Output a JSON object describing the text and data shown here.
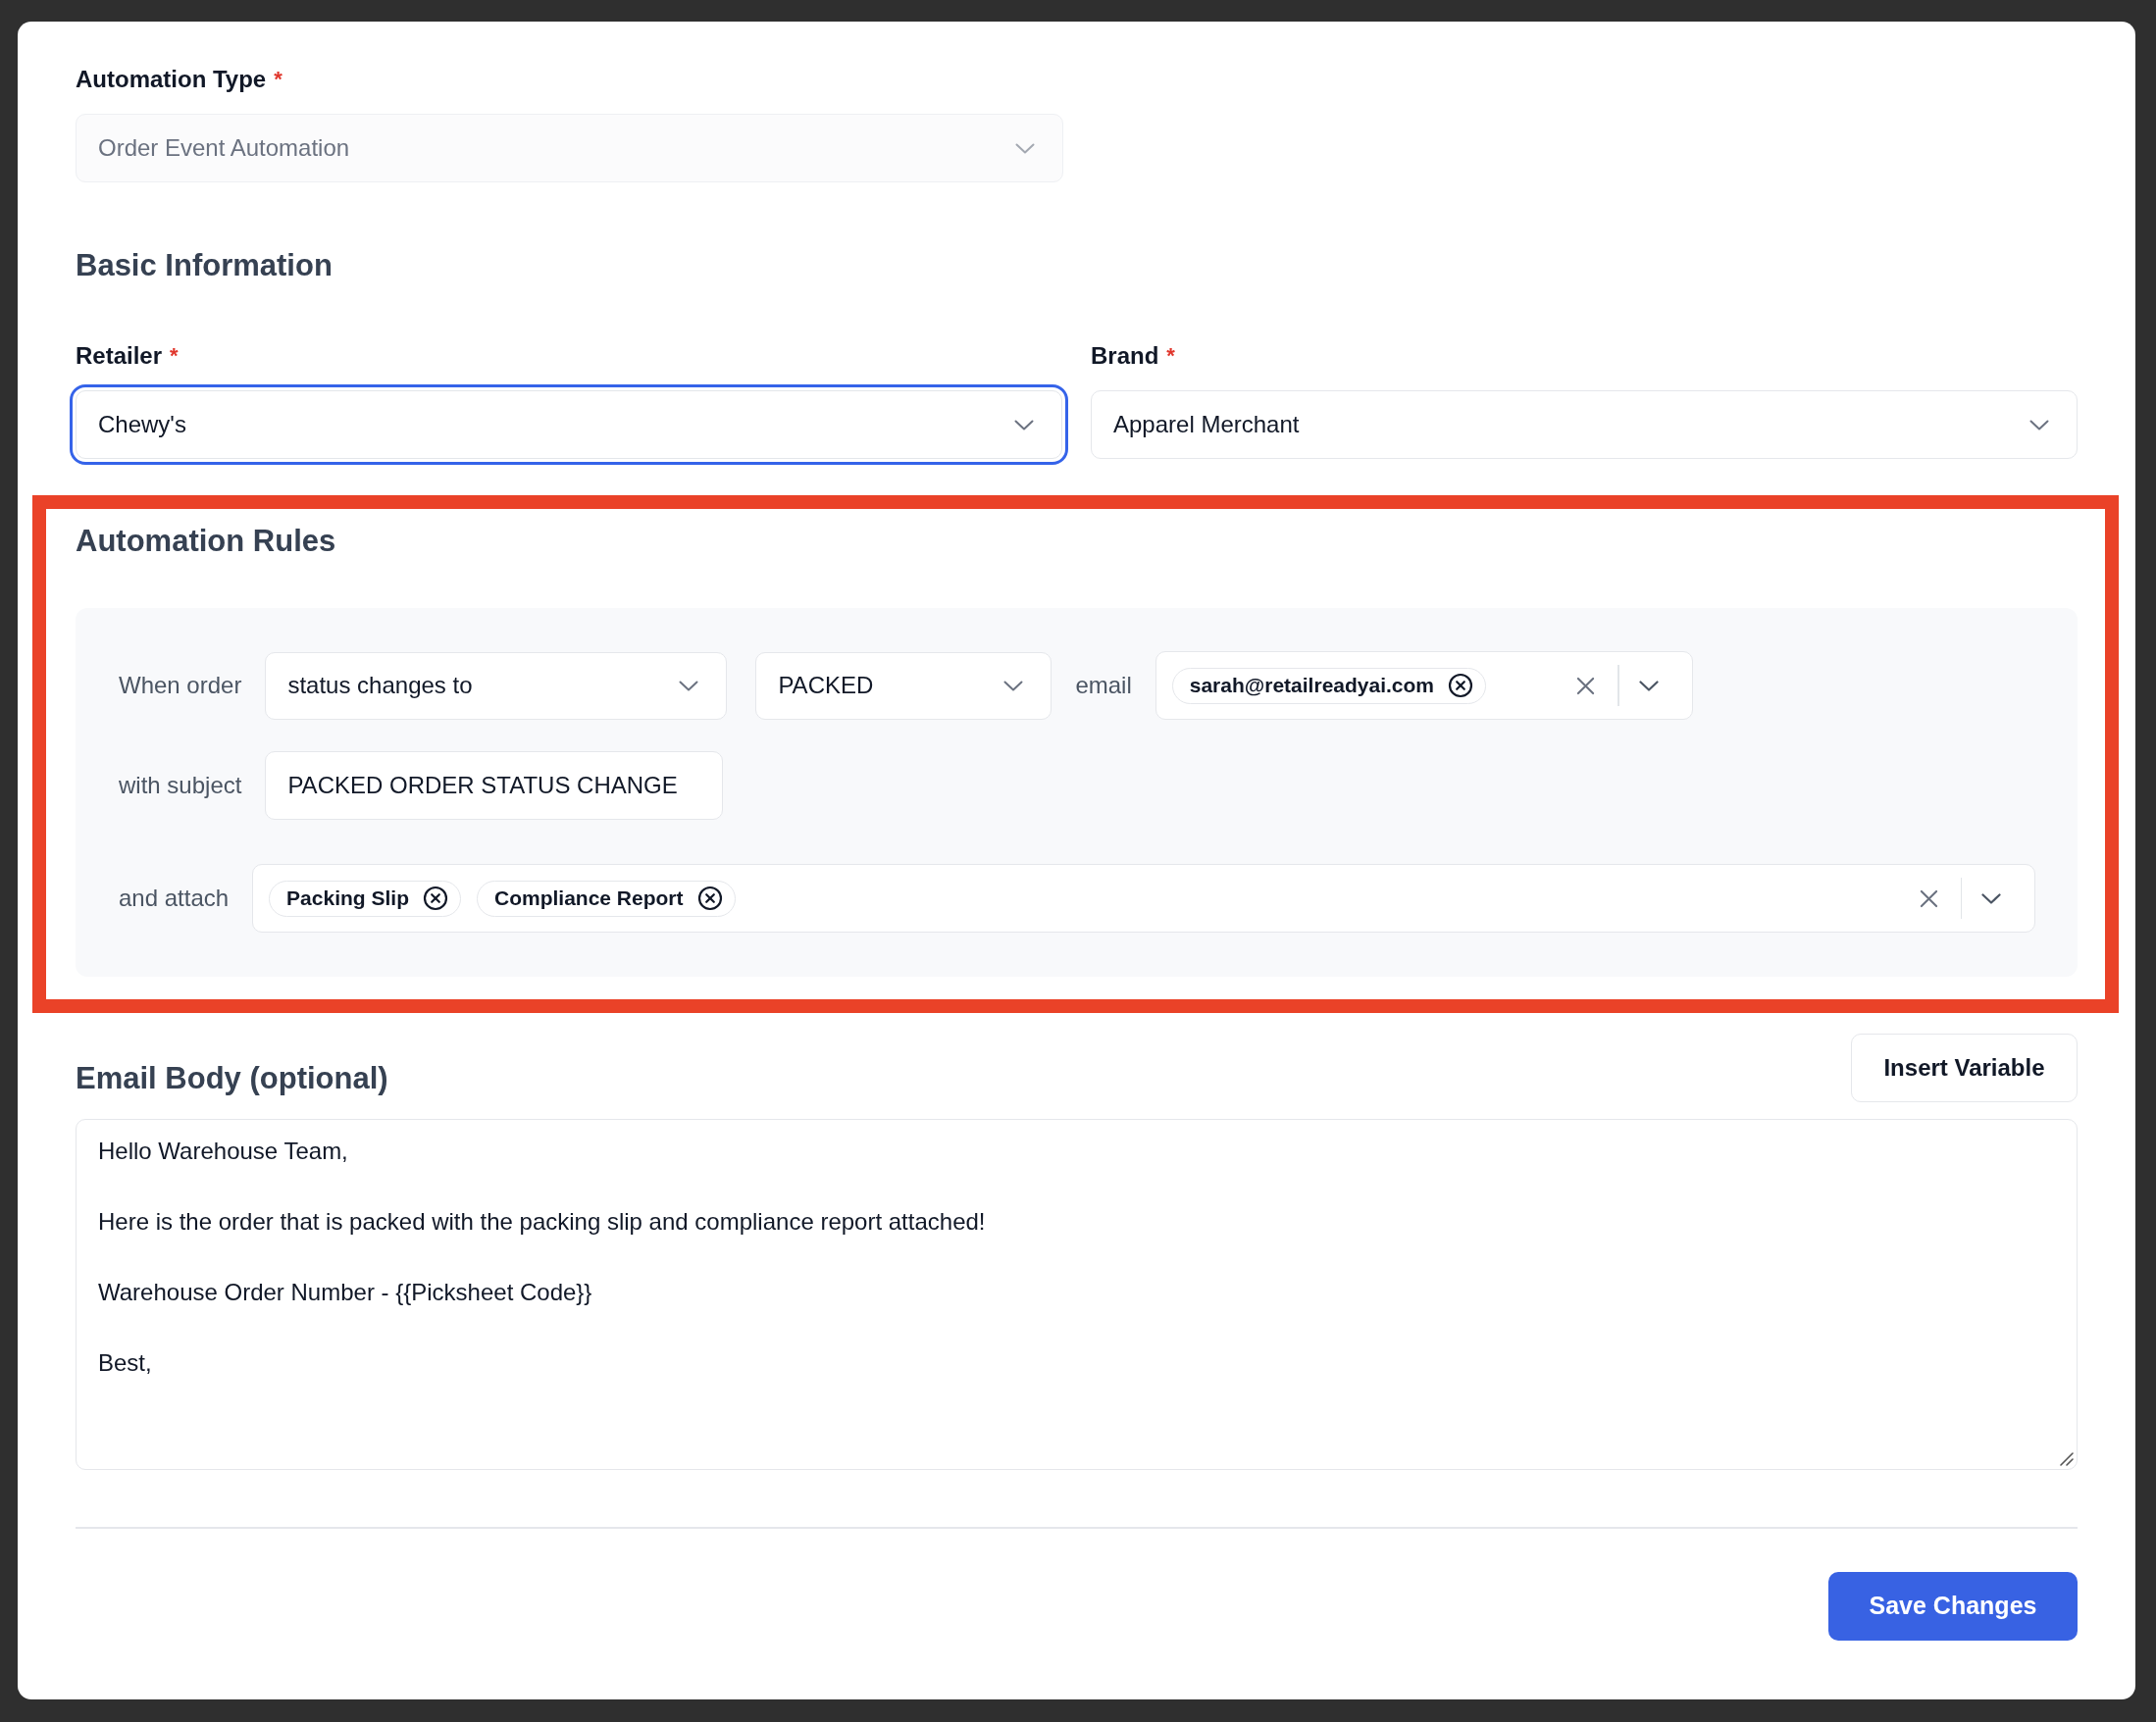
{
  "automation_type": {
    "label": "Automation Type",
    "required_mark": "*",
    "value": "Order Event Automation",
    "disabled": true
  },
  "basic_information": {
    "heading": "Basic Information",
    "fields": [
      {
        "label": "Retailer",
        "required_mark": "*",
        "value": "Chewy's",
        "focused": true
      },
      {
        "label": "Brand",
        "required_mark": "*",
        "value": "Apparel Merchant",
        "focused": false
      }
    ]
  },
  "automation_rules": {
    "heading": "Automation Rules",
    "highlighted": true,
    "rows": [
      {
        "items": [
          {
            "kind": "label",
            "text": "When order"
          },
          {
            "kind": "select",
            "value": "status changes to"
          },
          {
            "kind": "select",
            "value": "PACKED"
          },
          {
            "kind": "label",
            "text": "email"
          },
          {
            "kind": "multiselect",
            "chips": [
              "sarah@retailreadyai.com"
            ]
          }
        ]
      },
      {
        "items": [
          {
            "kind": "label",
            "text": "with subject"
          },
          {
            "kind": "input",
            "value": "PACKED ORDER STATUS CHANGE"
          }
        ]
      },
      {
        "items": [
          {
            "kind": "label",
            "text": "and attach"
          },
          {
            "kind": "multiselect",
            "chips": [
              "Packing Slip",
              "Compliance Report"
            ]
          }
        ]
      }
    ]
  },
  "email_body": {
    "heading": "Email Body (optional)",
    "insert_button": "Insert Variable",
    "paragraphs": [
      "Hello Warehouse Team,",
      "Here is the order that is packed with the packing slip and compliance report attached!",
      "Warehouse Order Number - {{Picksheet Code}}",
      "Best,"
    ]
  },
  "save_button": "Save Changes"
}
